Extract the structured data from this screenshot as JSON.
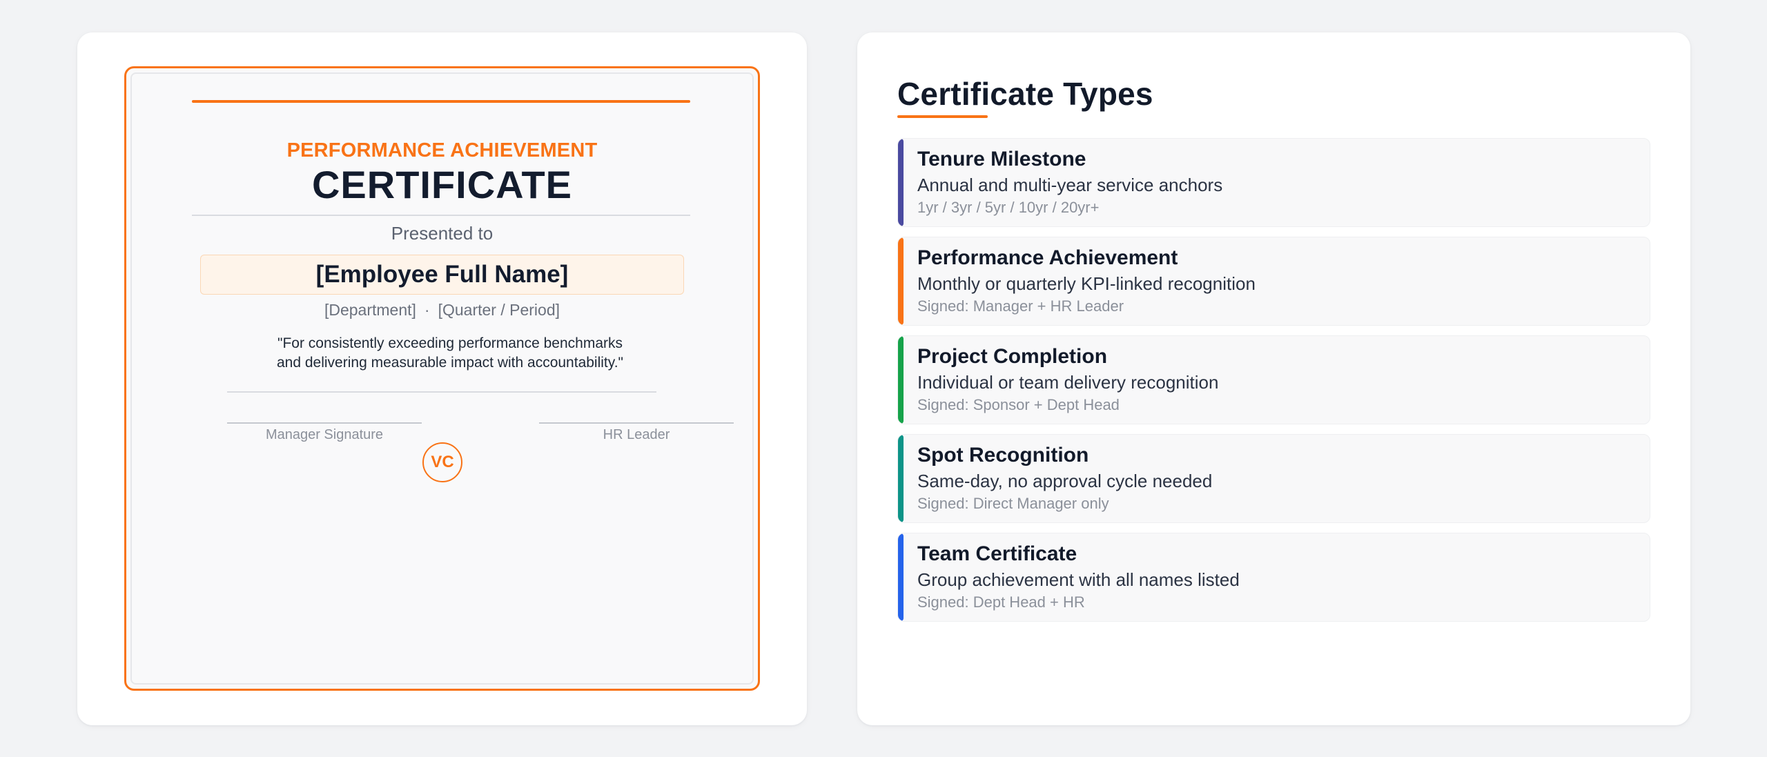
{
  "certificate_preview": {
    "kicker": "PERFORMANCE ACHIEVEMENT",
    "title": "CERTIFICATE",
    "presented_to": "Presented to",
    "employee_name": "[Employee Full Name]",
    "department": "[Department]",
    "separator": "·",
    "period": "[Quarter / Period]",
    "citation_line1": "\"For consistently exceeding performance benchmarks",
    "citation_line2": "and delivering measurable impact with accountability.\"",
    "signature_left": "Manager Signature",
    "signature_right": "HR Leader",
    "seal_initials": "VC",
    "accent_color": "#f97316"
  },
  "certificate_types": {
    "heading": "Certificate Types",
    "items": [
      {
        "name": "Tenure Milestone",
        "description": "Annual and multi-year service anchors",
        "detail": "1yr / 3yr / 5yr / 10yr / 20yr+",
        "color": "#4a4aa0"
      },
      {
        "name": "Performance Achievement",
        "description": "Monthly or quarterly KPI-linked recognition",
        "detail": "Signed: Manager + HR Leader",
        "color": "#f97316"
      },
      {
        "name": "Project Completion",
        "description": "Individual or team delivery recognition",
        "detail": "Signed: Sponsor + Dept Head",
        "color": "#16a34a"
      },
      {
        "name": "Spot Recognition",
        "description": "Same-day, no approval cycle needed",
        "detail": "Signed: Direct Manager only",
        "color": "#0d9488"
      },
      {
        "name": "Team Certificate",
        "description": "Group achievement with all names listed",
        "detail": "Signed: Dept Head + HR",
        "color": "#2563eb"
      }
    ]
  }
}
